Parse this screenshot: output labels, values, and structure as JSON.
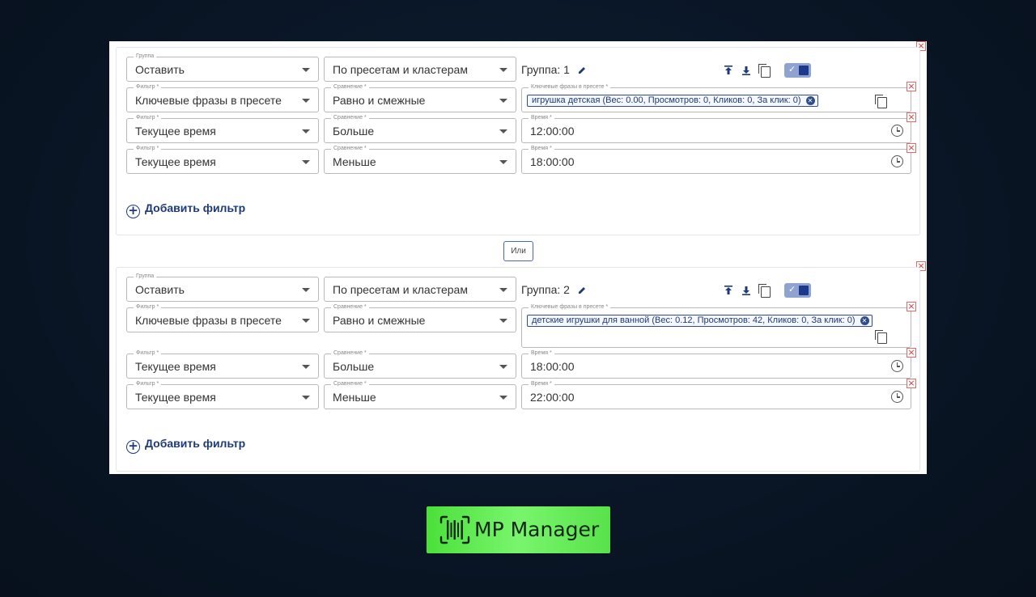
{
  "groups": [
    {
      "group_field": {
        "label": "Группа",
        "value": "Оставить"
      },
      "source_field": {
        "value": "По пресетам и кластерам"
      },
      "title": "Группа: 1",
      "rows": [
        {
          "filter_label": "Фильтр *",
          "filter": "Ключевые фразы в пресете",
          "compare_label": "Сравнение *",
          "compare": "Равно и смежные",
          "value_label": "Ключевые фразы в пресете *",
          "chip": "игрушка детская (Вес: 0.00, Просмотров: 0, Кликов: 0, За клик: 0)"
        },
        {
          "filter_label": "Фильтр *",
          "filter": "Текущее время",
          "compare_label": "Сравнение *",
          "compare": "Больше",
          "value_label": "Время *",
          "value": "12:00:00"
        },
        {
          "filter_label": "Фильтр *",
          "filter": "Текущее время",
          "compare_label": "Сравнение *",
          "compare": "Меньше",
          "value_label": "Время *",
          "value": "18:00:00"
        }
      ],
      "add_filter": "Добавить фильтр"
    },
    {
      "group_field": {
        "label": "Группа",
        "value": "Оставить"
      },
      "source_field": {
        "value": "По пресетам и кластерам"
      },
      "title": "Группа: 2",
      "rows": [
        {
          "filter_label": "Фильтр *",
          "filter": "Ключевые фразы в пресете",
          "compare_label": "Сравнение *",
          "compare": "Равно и смежные",
          "value_label": "Ключевые фразы в пресете *",
          "chip": "детские игрушки для ванной (Вес: 0.12, Просмотров: 42, Кликов: 0, За клик: 0)"
        },
        {
          "filter_label": "Фильтр *",
          "filter": "Текущее время",
          "compare_label": "Сравнение *",
          "compare": "Больше",
          "value_label": "Время *",
          "value": "18:00:00"
        },
        {
          "filter_label": "Фильтр *",
          "filter": "Текущее время",
          "compare_label": "Сравнение *",
          "compare": "Меньше",
          "value_label": "Время *",
          "value": "22:00:00"
        }
      ],
      "add_filter": "Добавить фильтр"
    }
  ],
  "or_label": "Или",
  "logo": {
    "text": "MP Manager",
    "color": "#4be03a"
  },
  "icons": [
    "close-icon",
    "chevron-down-icon",
    "pencil-icon",
    "move-top-icon",
    "move-bottom-icon",
    "copy-icon",
    "toggle-check-icon",
    "clock-icon",
    "chip-remove-icon",
    "add-circle-icon",
    "barcode-logo-icon"
  ]
}
